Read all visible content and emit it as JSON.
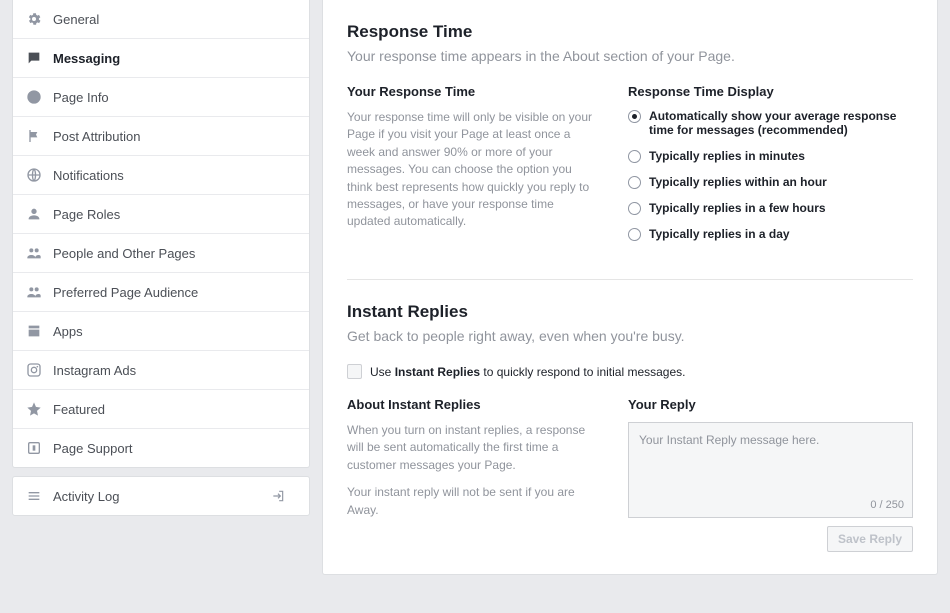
{
  "sidebar": {
    "items": [
      {
        "label": "General"
      },
      {
        "label": "Messaging"
      },
      {
        "label": "Page Info"
      },
      {
        "label": "Post Attribution"
      },
      {
        "label": "Notifications"
      },
      {
        "label": "Page Roles"
      },
      {
        "label": "People and Other Pages"
      },
      {
        "label": "Preferred Page Audience"
      },
      {
        "label": "Apps"
      },
      {
        "label": "Instagram Ads"
      },
      {
        "label": "Featured"
      },
      {
        "label": "Page Support"
      }
    ],
    "activity": "Activity Log"
  },
  "rt": {
    "title": "Response Time",
    "subtitle": "Your response time appears in the About section of your Page.",
    "col_left_title": "Your Response Time",
    "col_left_body": "Your response time will only be visible on your Page if you visit your Page at least once a week and answer 90% or more of your messages. You can choose the option you think best represents how quickly you reply to messages, or have your response time updated automatically.",
    "col_right_title": "Response Time Display",
    "options": [
      "Automatically show your average response time for messages (recommended)",
      "Typically replies in minutes",
      "Typically replies within an hour",
      "Typically replies in a few hours",
      "Typically replies in a day"
    ]
  },
  "ir": {
    "title": "Instant Replies",
    "subtitle": "Get back to people right away, even when you're busy.",
    "chk_pre": "Use ",
    "chk_bold": "Instant Replies",
    "chk_post": " to quickly respond to initial messages.",
    "about_title": "About Instant Replies",
    "about_p1": "When you turn on instant replies, a response will be sent automatically the first time a customer messages your Page.",
    "about_p2": "Your instant reply will not be sent if you are Away.",
    "reply_title": "Your Reply",
    "placeholder": "Your Instant Reply message here.",
    "counter": "0 / 250",
    "save": "Save Reply"
  }
}
